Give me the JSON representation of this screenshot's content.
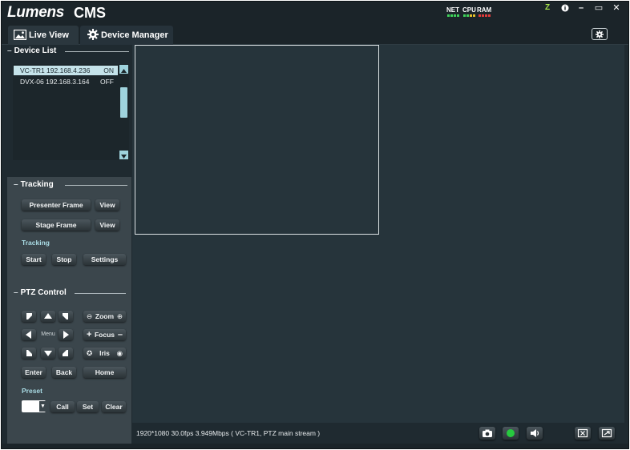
{
  "titlebar": {
    "logo": "Lumens",
    "app_name": "CMS",
    "meters": [
      {
        "label": "NET",
        "colors": [
          "#3fd35a",
          "#3fd35a",
          "#3fd35a",
          "#3fd35a"
        ]
      },
      {
        "label": "CPU",
        "colors": [
          "#3fd35a",
          "#3fd35a",
          "#e7c22b",
          "#e7c22b"
        ]
      },
      {
        "label": "RAM",
        "colors": [
          "#e23b3b",
          "#e23b3b",
          "#e23b3b",
          "#e23b3b"
        ]
      }
    ],
    "window_buttons": {
      "sleep": "Z",
      "info": "i",
      "minimize": "–",
      "maximize": "▭",
      "close": "✕"
    },
    "sleep_color": "#a6e34a"
  },
  "tabs": [
    {
      "label": "Live View",
      "icon": "image-icon",
      "active": true
    },
    {
      "label": "Device Manager",
      "icon": "gear-icon",
      "active": false
    }
  ],
  "device_list": {
    "title": "Device List",
    "devices": [
      {
        "name": "VC-TR1 192.168.4.236",
        "status": "ON",
        "selected": true
      },
      {
        "name": "DVX-06 192.168.3.164",
        "status": "OFF",
        "selected": false
      }
    ]
  },
  "tracking": {
    "title": "Tracking",
    "presenter_frame": "Presenter Frame",
    "stage_frame": "Stage Frame",
    "view": "View",
    "sub_title": "Tracking",
    "start": "Start",
    "stop": "Stop",
    "settings": "Settings"
  },
  "ptz": {
    "title": "PTZ Control",
    "menu": "Menu",
    "zoom": "Zoom",
    "focus": "Focus",
    "iris": "Iris",
    "enter": "Enter",
    "back": "Back",
    "home": "Home"
  },
  "preset": {
    "title": "Preset",
    "value": "",
    "call": "Call",
    "set": "Set",
    "clear": "Clear"
  },
  "status_bar": {
    "text": "1920*1080  30.0fps  3.949Mbps  ( VC-TR1, PTZ main stream )"
  },
  "colors": {
    "accent": "#9fd3dd",
    "record_green": "#27c93f"
  }
}
